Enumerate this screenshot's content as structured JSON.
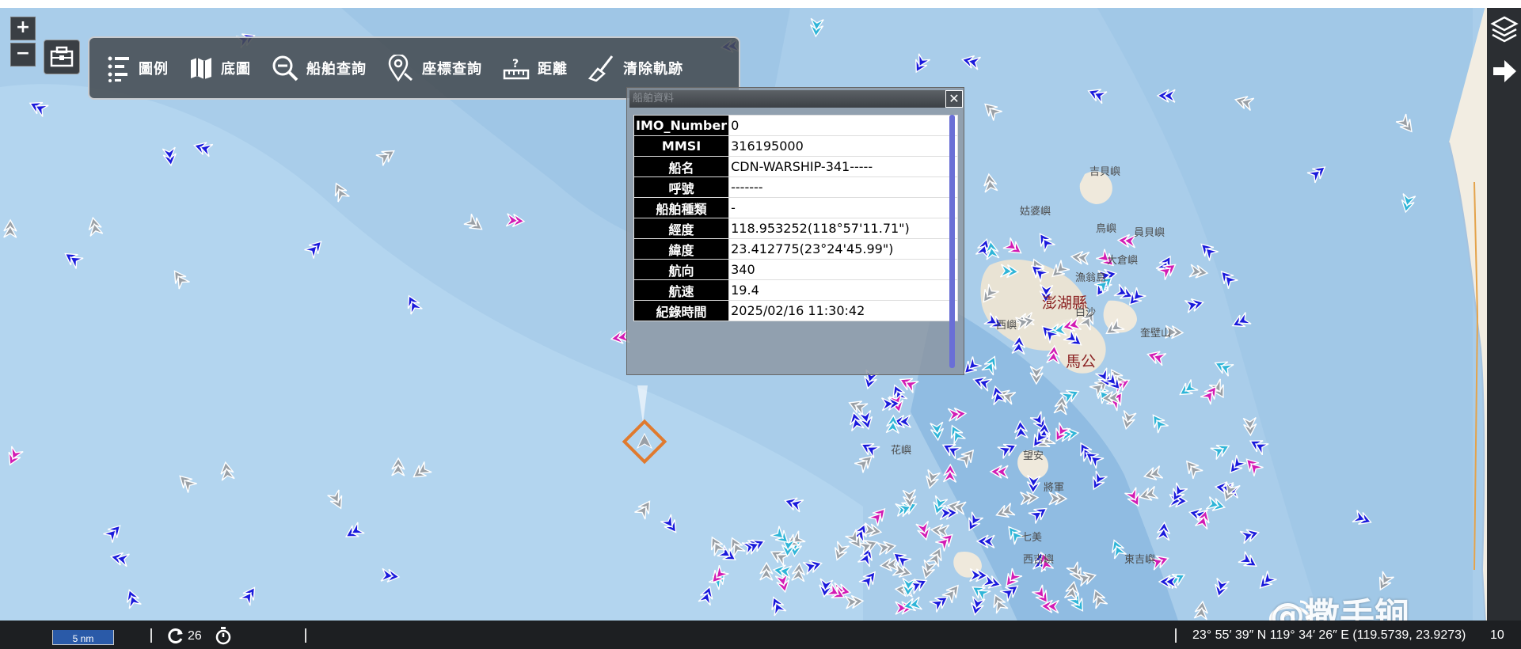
{
  "map": {
    "zoom_in_label": "+",
    "zoom_out_label": "−",
    "toolbar": [
      {
        "label": "圖例",
        "icon": "list-icon"
      },
      {
        "label": "底圖",
        "icon": "map-icon"
      },
      {
        "label": "船舶查詢",
        "icon": "zoom-search-icon"
      },
      {
        "label": "座標查詢",
        "icon": "location-search-icon"
      },
      {
        "label": "距離",
        "icon": "ruler-icon"
      },
      {
        "label": "清除軌跡",
        "icon": "broom-icon"
      }
    ],
    "place_names": [
      "澎湖縣",
      "馬公",
      "吉貝嶼",
      "姑婆嶼",
      "鳥嶼",
      "員貝嶼",
      "西嶼",
      "白沙",
      "望安",
      "七美",
      "將軍",
      "花嶼",
      "東吉嶼",
      "西吉嶼",
      "奎壁山",
      "漁翁島",
      "大倉嶼"
    ]
  },
  "info_panel": {
    "title": "船舶資料",
    "close_label": "✕",
    "rows": [
      {
        "key": "IMO_Number",
        "value": "0"
      },
      {
        "key": "MMSI",
        "value": "316195000"
      },
      {
        "key": "船名",
        "value": "CDN-WARSHIP-341-----"
      },
      {
        "key": "呼號",
        "value": "-------"
      },
      {
        "key": "船舶種類",
        "value": "-"
      },
      {
        "key": "經度",
        "value": "118.953252(118°57'11.71\")"
      },
      {
        "key": "緯度",
        "value": "23.412775(23°24'45.99\")"
      },
      {
        "key": "航向",
        "value": "340"
      },
      {
        "key": "航速",
        "value": "19.4"
      },
      {
        "key": "紀錄時間",
        "value": "2025/02/16 11:30:42"
      }
    ]
  },
  "statusbar": {
    "scale_label": "5 nm",
    "refresh_count": "26",
    "coordinates": "23° 55′ 39″ N 119° 34′ 26″ E (119.5739, 23.9273)",
    "tail": "10"
  },
  "watermark": "@撒手锏",
  "colors": {
    "sea_light": "#b6d6ef",
    "sea_mid": "#a2c8e8",
    "sea_deep": "#8ab8e0",
    "ship_blue": "#1a1adc",
    "ship_cyan": "#2fb5d8",
    "ship_gray": "#9aa0a6",
    "ship_magenta": "#d21bb4",
    "selected_ring": "#e07a2e",
    "toolbar_bg": "#464c52"
  }
}
